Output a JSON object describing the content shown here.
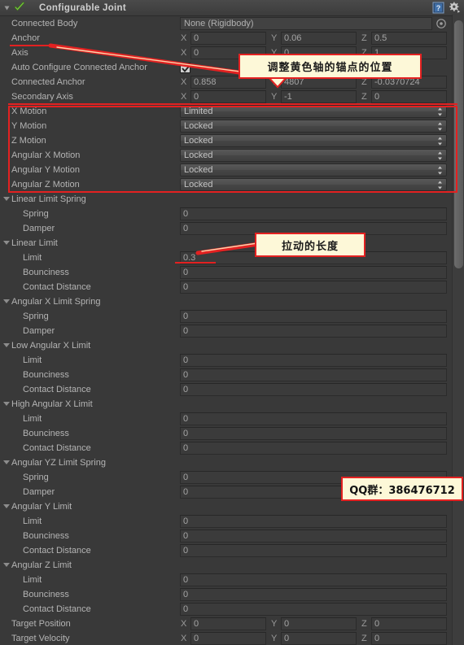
{
  "header": {
    "title": "Configurable Joint",
    "icons": {
      "foldout": "foldout-triangle",
      "component": "joint-check-icon",
      "help": "help-icon",
      "gear": "gear-icon"
    }
  },
  "fields": {
    "connected_body": {
      "label": "Connected Body",
      "value": "None (Rigidbody)"
    },
    "anchor": {
      "label": "Anchor",
      "x": "0",
      "y": "0.06",
      "z": "0.5"
    },
    "axis": {
      "label": "Axis",
      "x": "0",
      "y": "0",
      "z": "1"
    },
    "auto_configure": {
      "label": "Auto Configure Connected Anchor",
      "checked": true
    },
    "connected_anchor": {
      "label": "Connected Anchor",
      "x": "0.858",
      "y": "4807",
      "z": "-0.0370724"
    },
    "secondary_axis": {
      "label": "Secondary Axis",
      "x": "0",
      "y": "-1",
      "z": "0"
    },
    "x_motion": {
      "label": "X Motion",
      "value": "Limited"
    },
    "y_motion": {
      "label": "Y Motion",
      "value": "Locked"
    },
    "z_motion": {
      "label": "Z Motion",
      "value": "Locked"
    },
    "ang_x_motion": {
      "label": "Angular X Motion",
      "value": "Locked"
    },
    "ang_y_motion": {
      "label": "Angular Y Motion",
      "value": "Locked"
    },
    "ang_z_motion": {
      "label": "Angular Z Motion",
      "value": "Locked"
    },
    "linear_limit_spring": {
      "label": "Linear Limit Spring",
      "spring_label": "Spring",
      "spring": "0",
      "damper_label": "Damper",
      "damper": "0"
    },
    "linear_limit": {
      "label": "Linear Limit",
      "limit_label": "Limit",
      "limit": "0.3",
      "bounciness_label": "Bounciness",
      "bounciness": "0",
      "contact_label": "Contact Distance",
      "contact": "0"
    },
    "ang_x_limit_spring": {
      "label": "Angular X Limit Spring",
      "spring_label": "Spring",
      "spring": "0",
      "damper_label": "Damper",
      "damper": "0"
    },
    "low_ang_x_limit": {
      "label": "Low Angular X Limit",
      "limit_label": "Limit",
      "limit": "0",
      "bounciness_label": "Bounciness",
      "bounciness": "0",
      "contact_label": "Contact Distance",
      "contact": "0"
    },
    "high_ang_x_limit": {
      "label": "High Angular X Limit",
      "limit_label": "Limit",
      "limit": "0",
      "bounciness_label": "Bounciness",
      "bounciness": "0",
      "contact_label": "Contact Distance",
      "contact": "0"
    },
    "ang_yz_limit_spring": {
      "label": "Angular YZ Limit Spring",
      "spring_label": "Spring",
      "spring": "0",
      "damper_label": "Damper",
      "damper": "0"
    },
    "ang_y_limit": {
      "label": "Angular Y Limit",
      "limit_label": "Limit",
      "limit": "0",
      "bounciness_label": "Bounciness",
      "bounciness": "0",
      "contact_label": "Contact Distance",
      "contact": "0"
    },
    "ang_z_limit": {
      "label": "Angular Z Limit",
      "limit_label": "Limit",
      "limit": "0",
      "bounciness_label": "Bounciness",
      "bounciness": "0",
      "contact_label": "Contact Distance",
      "contact": "0"
    },
    "target_position": {
      "label": "Target Position",
      "x": "0",
      "y": "0",
      "z": "0"
    },
    "target_velocity": {
      "label": "Target Velocity",
      "x": "0",
      "y": "0",
      "z": "0"
    }
  },
  "axes": {
    "x": "X",
    "y": "Y",
    "z": "Z"
  },
  "annotations": {
    "callout_anchor": "调整黄色轴的锚点的位置",
    "callout_limit": "拉动的长度",
    "watermark": "QQ群：386476712",
    "accent_color": "#e32121",
    "callout_bg": "#fdf8d8"
  }
}
